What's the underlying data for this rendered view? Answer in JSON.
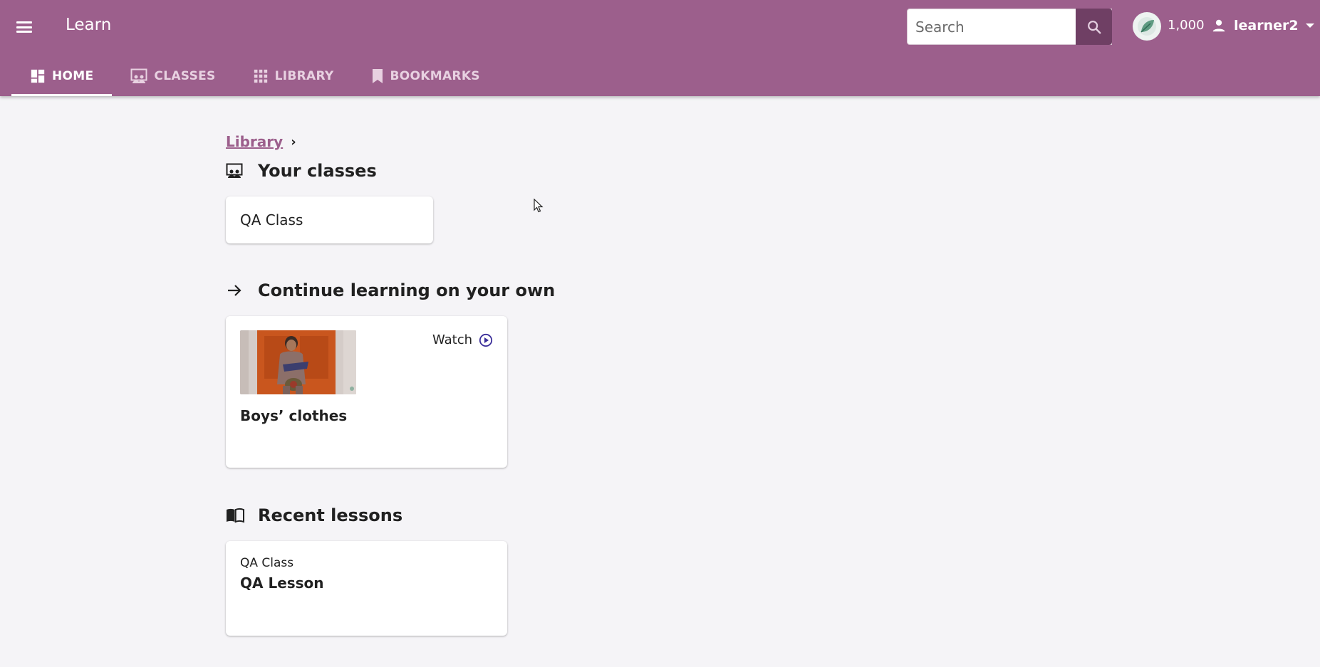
{
  "app": {
    "title": "Learn"
  },
  "search": {
    "placeholder": "Search"
  },
  "points": {
    "value": "1,000"
  },
  "user": {
    "name": "learner2"
  },
  "tabs": [
    {
      "label": "HOME",
      "icon": "dashboard-icon",
      "active": true
    },
    {
      "label": "CLASSES",
      "icon": "classroom-icon",
      "active": false
    },
    {
      "label": "LIBRARY",
      "icon": "apps-grid-icon",
      "active": false
    },
    {
      "label": "BOOKMARKS",
      "icon": "bookmark-icon",
      "active": false
    }
  ],
  "breadcrumb": {
    "link": "Library",
    "separator": "›"
  },
  "sections": {
    "classes": {
      "heading": "Your classes",
      "items": [
        {
          "name": "QA Class"
        }
      ]
    },
    "continue": {
      "heading": "Continue learning on your own",
      "items": [
        {
          "title": "Boys’ clothes",
          "action": "Watch"
        }
      ]
    },
    "lessons": {
      "heading": "Recent lessons",
      "items": [
        {
          "class_name": "QA Class",
          "title": "QA Lesson"
        }
      ]
    }
  },
  "colors": {
    "appbar": "#9c5f8c",
    "search_button": "#6f3f64",
    "background": "#f5f4f7",
    "watch_icon": "#3b2e9a"
  }
}
